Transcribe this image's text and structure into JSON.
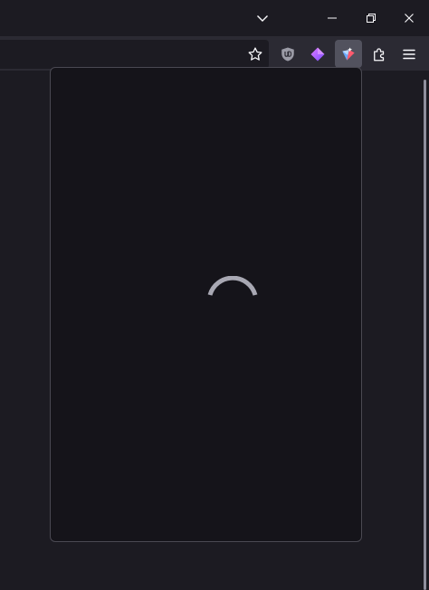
{
  "window": {
    "icons": {
      "tabs_list": "chevron-down-icon",
      "minimize": "minimize-icon",
      "restore": "restore-icon",
      "close": "close-icon"
    }
  },
  "toolbar": {
    "icons": {
      "bookmark": "star-icon",
      "ublock": "ublock-origin-icon",
      "extension_purple": "purple-diamond-icon",
      "extension_active": "active-extension-icon",
      "extensions": "puzzle-piece-icon",
      "menu": "hamburger-menu-icon"
    }
  },
  "popup": {
    "state": "loading"
  },
  "colors": {
    "background": "#1c1b22",
    "toolbar": "#2b2a33",
    "popup": "#15141a",
    "spinner": "#a8a8b3"
  }
}
